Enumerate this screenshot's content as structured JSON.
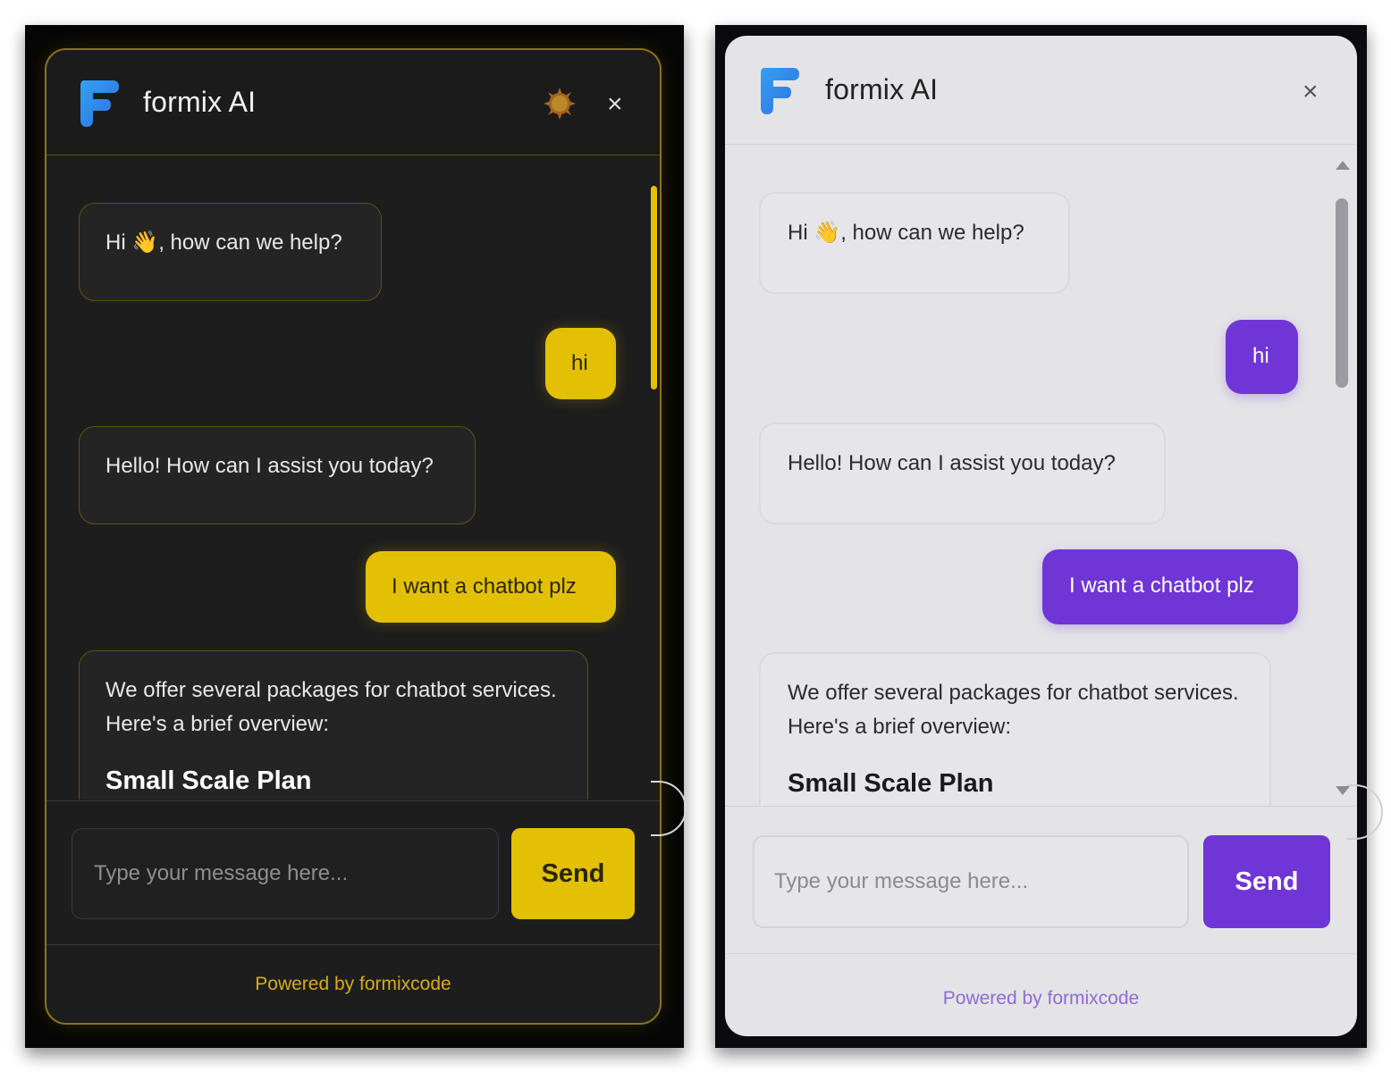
{
  "panels": [
    {
      "theme": "dark",
      "header": {
        "title": "formix AI",
        "theme_toggle_icon": "sun-icon",
        "close_icon": "close-icon",
        "close_glyph": "×"
      },
      "messages": [
        {
          "role": "bot",
          "text": "Hi 👋, how can we help?"
        },
        {
          "role": "user",
          "text": "hi"
        },
        {
          "role": "bot",
          "text": "Hello! How can I assist you today?"
        },
        {
          "role": "user",
          "text": "I want a chatbot plz"
        },
        {
          "role": "bot",
          "text": "We offer several packages for chatbot services. Here's a brief overview:",
          "heading": "Small Scale Plan"
        }
      ],
      "input": {
        "placeholder": "Type your message here...",
        "value": ""
      },
      "send_label": "Send",
      "footer": "Powered by formixcode",
      "colors": {
        "accent": "#e3c004",
        "background": "#1d1d1d",
        "border": "#8a7415"
      }
    },
    {
      "theme": "light",
      "header": {
        "title": "formix AI",
        "theme_toggle_icon": "moon-icon",
        "close_icon": "close-icon",
        "close_glyph": "×"
      },
      "messages": [
        {
          "role": "bot",
          "text": "Hi 👋, how can we help?"
        },
        {
          "role": "user",
          "text": "hi"
        },
        {
          "role": "bot",
          "text": "Hello! How can I assist you today?"
        },
        {
          "role": "user",
          "text": "I want a chatbot plz"
        },
        {
          "role": "bot",
          "text": "We offer several packages for chatbot services. Here's a brief overview:",
          "heading": "Small Scale Plan"
        }
      ],
      "input": {
        "placeholder": "Type your message here...",
        "value": ""
      },
      "send_label": "Send",
      "footer": "Powered by formixcode",
      "colors": {
        "accent": "#7035d6",
        "background": "#e4e4e7",
        "border": "#d9d9de"
      }
    }
  ]
}
